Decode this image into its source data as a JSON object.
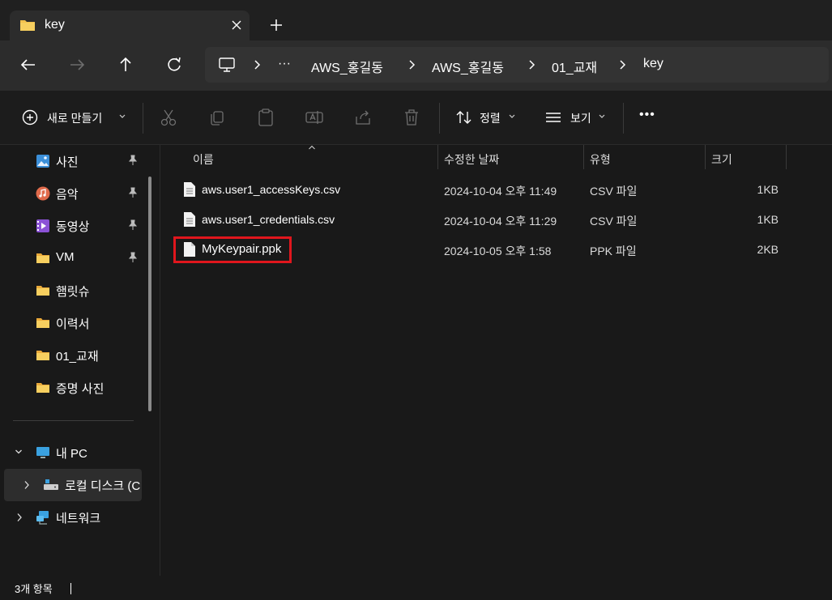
{
  "window": {
    "tab_title": "key"
  },
  "nav": {
    "breadcrumbs": [
      "AWS_홍길동",
      "AWS_홍길동",
      "01_교재",
      "key"
    ],
    "overflow": "···"
  },
  "toolbar": {
    "new_label": "새로 만들기",
    "sort_label": "정렬",
    "view_label": "보기",
    "more": "•••"
  },
  "sidebar": {
    "quick_access": [
      {
        "label": "사진",
        "icon": "photos-icon",
        "pinned": true
      },
      {
        "label": "음악",
        "icon": "music-icon",
        "pinned": true
      },
      {
        "label": "동영상",
        "icon": "videos-icon",
        "pinned": true
      },
      {
        "label": "VM",
        "icon": "folder-icon",
        "pinned": true
      },
      {
        "label": "햄릿슈",
        "icon": "folder-icon",
        "pinned": false
      },
      {
        "label": "이력서",
        "icon": "folder-icon",
        "pinned": false
      },
      {
        "label": "01_교재",
        "icon": "folder-icon",
        "pinned": false
      },
      {
        "label": "증명 사진",
        "icon": "folder-icon",
        "pinned": false
      }
    ],
    "this_pc": "내 PC",
    "local_disk": "로컬 디스크 (C",
    "network": "네트워크"
  },
  "columns": {
    "name": "이름",
    "date": "수정한 날짜",
    "type": "유형",
    "size": "크기"
  },
  "files": [
    {
      "name": "aws.user1_accessKeys.csv",
      "date": "2024-10-04 오후 11:49",
      "type": "CSV 파일",
      "size": "1KB"
    },
    {
      "name": "aws.user1_credentials.csv",
      "date": "2024-10-04 오후 11:29",
      "type": "CSV 파일",
      "size": "1KB"
    },
    {
      "name": "MyKeypair.ppk",
      "date": "2024-10-05 오후 1:58",
      "type": "PPK 파일",
      "size": "2KB"
    }
  ],
  "status": {
    "item_count": "3개 항목"
  },
  "colors": {
    "highlight": "#e0161d",
    "folder": "#f2c14e",
    "background": "#191919"
  }
}
